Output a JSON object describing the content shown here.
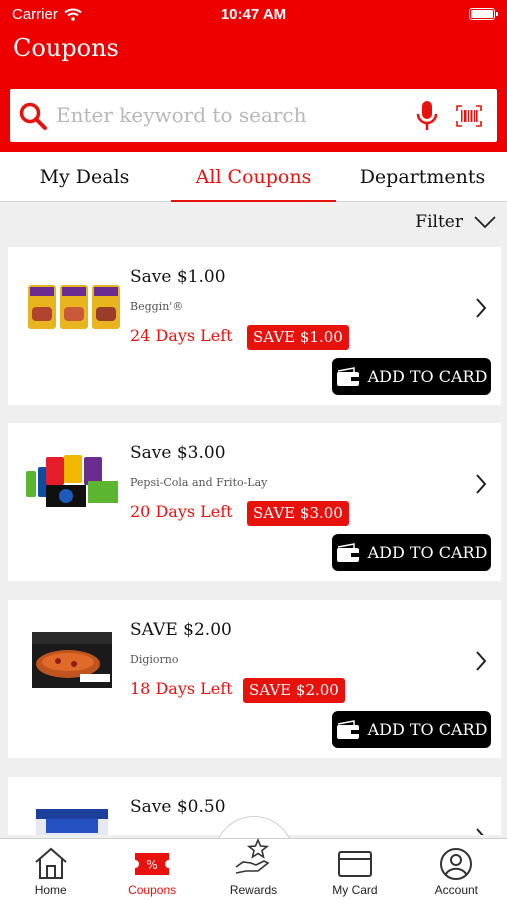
{
  "status": {
    "carrier": "Carrier",
    "time": "10:47 AM"
  },
  "header": {
    "title": "Coupons"
  },
  "search": {
    "placeholder": "Enter keyword to search"
  },
  "tabs": [
    {
      "label": "My Deals",
      "active": false
    },
    {
      "label": "All Coupons",
      "active": true
    },
    {
      "label": "Departments",
      "active": false
    }
  ],
  "filter": {
    "label": "Filter"
  },
  "coupons": [
    {
      "headline": "Save $1.00",
      "brand": "Beggin'®",
      "days": "24 Days Left",
      "badge": "SAVE $1.00",
      "button": "ADD TO CARD"
    },
    {
      "headline": "Save $3.00",
      "brand": "Pepsi-Cola and Frito-Lay",
      "days": "20 Days Left",
      "badge": "SAVE $3.00",
      "button": "ADD TO CARD"
    },
    {
      "headline": "SAVE $2.00",
      "brand": "Digiorno",
      "days": "18 Days Left",
      "badge": "SAVE $2.00",
      "button": "ADD TO CARD"
    },
    {
      "headline": "Save $0.50",
      "brand": "",
      "days": "",
      "badge": "",
      "button": ""
    }
  ],
  "nav": [
    {
      "label": "Home",
      "icon": "home-icon"
    },
    {
      "label": "Coupons",
      "icon": "coupon-icon",
      "active": true
    },
    {
      "label": "Rewards",
      "icon": "rewards-icon"
    },
    {
      "label": "My Card",
      "icon": "card-icon"
    },
    {
      "label": "Account",
      "icon": "account-icon"
    }
  ],
  "colors": {
    "brand": "#ee0000",
    "accent": "#e8120c",
    "button": "#000000"
  }
}
